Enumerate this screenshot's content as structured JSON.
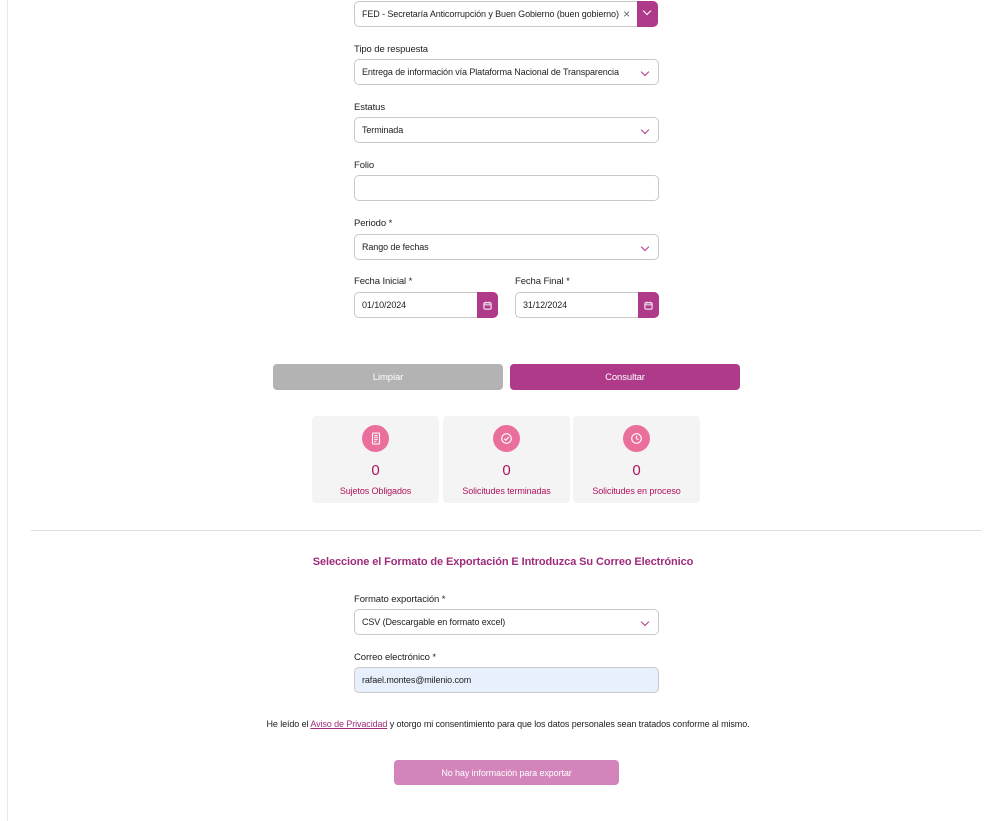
{
  "filters": {
    "sujeto_value": "FED - Secretaría Anticorrupción y  Buen Gobierno (buen gobierno)",
    "clear_symbol": "×",
    "tipo_label": "Tipo de respuesta",
    "tipo_value": "Entrega de información vía Plataforma Nacional de Transparencia",
    "estatus_label": "Estatus",
    "estatus_value": "Terminada",
    "folio_label": "Folio",
    "folio_value": "",
    "periodo_label": "Periodo *",
    "periodo_value": "Rango de fechas",
    "fecha_inicial_label": "Fecha Inicial *",
    "fecha_inicial_value": "01/10/2024",
    "fecha_final_label": "Fecha Final *",
    "fecha_final_value": "31/12/2024"
  },
  "actions": {
    "limpiar_label": "Limpiar",
    "consultar_label": "Consultar"
  },
  "stats": [
    {
      "icon": "document-icon",
      "value": "0",
      "caption": "Sujetos Obligados"
    },
    {
      "icon": "check-circle-icon",
      "value": "0",
      "caption": "Solicitudes terminadas"
    },
    {
      "icon": "clock-icon",
      "value": "0",
      "caption": "Solicitudes en proceso"
    }
  ],
  "export": {
    "title": "Seleccione el Formato de Exportación E Introduzca Su Correo Electrónico",
    "formato_label": "Formato exportación *",
    "formato_value": "CSV (Descargable en formato excel)",
    "correo_label": "Correo electrónico *",
    "correo_value": "rafael.montes@milenio.com",
    "privacy_prefix": "He leído el ",
    "privacy_link": "Aviso de Privacidad",
    "privacy_suffix": " y otorgo mi consentimiento para que los datos personales sean tratados conforme al mismo.",
    "export_button_label": "No hay información para exportar"
  },
  "colors": {
    "accent": "#b03a8a",
    "stat_icon_bg": "#ea6f9d",
    "stat_text": "#b1135c",
    "limpiar_bg": "#b3b3b3",
    "export_disabled_bg": "#d384bb",
    "email_bg": "#e8f0fe"
  }
}
